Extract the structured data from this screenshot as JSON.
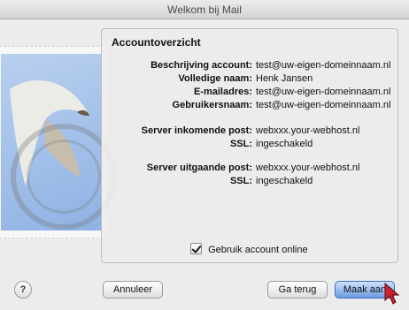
{
  "window": {
    "title": "Welkom bij Mail"
  },
  "summary": {
    "title": "Accountoverzicht",
    "rows": [
      {
        "label": "Beschrijving account:",
        "value": "test@uw-eigen-domeinnaam.nl"
      },
      {
        "label": "Volledige naam:",
        "value": "Henk Jansen"
      },
      {
        "label": "E-mailadres:",
        "value": "test@uw-eigen-domeinnaam.nl"
      },
      {
        "label": "Gebruikersnaam:",
        "value": "test@uw-eigen-domeinnaam.nl"
      },
      {
        "label": "Server inkomende post:",
        "value": "webxxx.your-webhost.nl"
      },
      {
        "label": "SSL:",
        "value": "ingeschakeld"
      },
      {
        "label": "Server uitgaande post:",
        "value": "webxxx.your-webhost.nl"
      },
      {
        "label": "SSL:",
        "value": "ingeschakeld"
      }
    ],
    "use_online": {
      "label": "Gebruik account online",
      "checked": true
    }
  },
  "footer": {
    "help_label": "?",
    "cancel_label": "Annuleer",
    "back_label": "Ga terug",
    "create_label": "Maak aan"
  },
  "icons": {
    "help": "question-mark-icon",
    "stamp": "mail-stamp-eagle-icon",
    "cursor": "mouse-pointer-icon"
  },
  "colors": {
    "primary_button": "#6a9be0",
    "cursor": "#d0202a",
    "stamp_blue": "#8fb2e4"
  }
}
